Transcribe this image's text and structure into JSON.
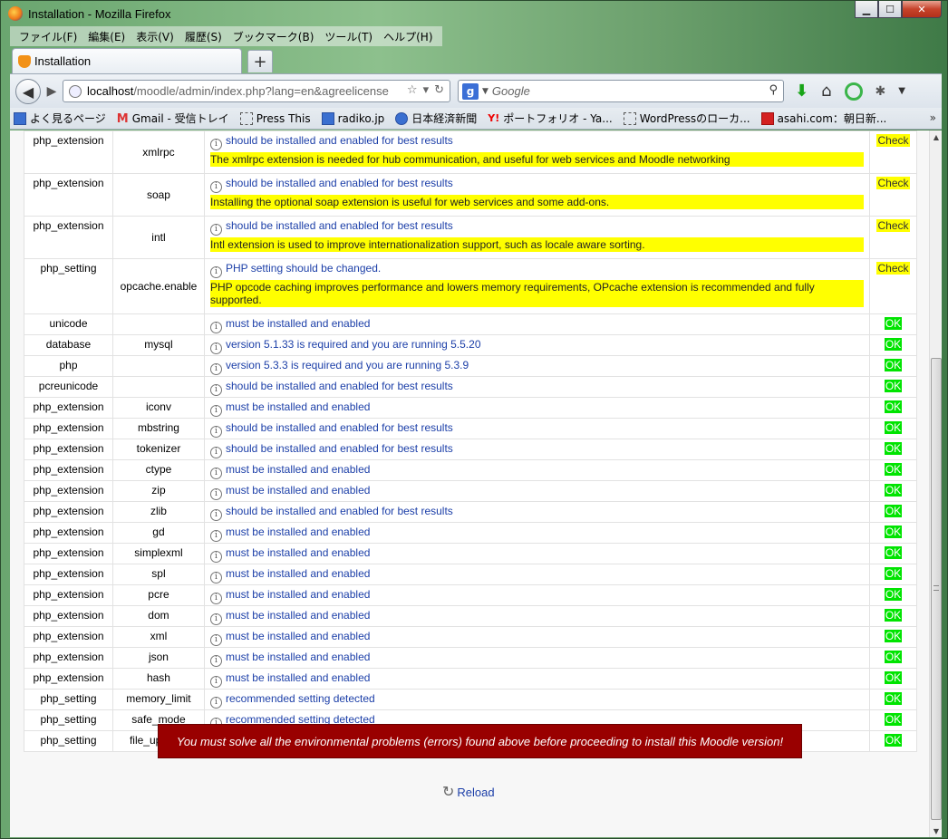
{
  "window": {
    "title": "Installation - Mozilla Firefox",
    "controls": {
      "minimize": "▁",
      "maximize": "☐",
      "close": "✕"
    }
  },
  "menubar": {
    "items": [
      "ファイル(F)",
      "編集(E)",
      "表示(V)",
      "履歴(S)",
      "ブックマーク(B)",
      "ツール(T)",
      "ヘルプ(H)"
    ]
  },
  "tabs": {
    "active_label": "Installation",
    "new_tab": "+"
  },
  "navbar": {
    "url_host": "localhost",
    "url_rest": "/moodle/admin/index.php?lang=en&agreelicense",
    "search_engine_letter": "g",
    "search_placeholder": "Google"
  },
  "bookmarks": {
    "items": [
      {
        "label": "よく見るページ",
        "icon": "bookmark-page-icon"
      },
      {
        "label": "Gmail - 受信トレイ",
        "icon": "gmail-icon"
      },
      {
        "label": "Press This",
        "icon": "dashed-page-icon"
      },
      {
        "label": "radiko.jp",
        "icon": "radiko-icon"
      },
      {
        "label": "日本経済新聞",
        "icon": "nikkei-icon"
      },
      {
        "label": "ポートフォリオ - Ya...",
        "icon": "yahoo-icon"
      },
      {
        "label": "WordPressのローカ...",
        "icon": "dashed-page-icon"
      },
      {
        "label": "asahi.com：朝日新...",
        "icon": "asahi-icon"
      }
    ],
    "more": "»"
  },
  "env_rows": [
    {
      "type": "php_extension",
      "name": "xmlrpc",
      "message": "should be installed and enabled for best results",
      "feedback": "The xmlrpc extension is needed for hub communication, and useful for web services and Moodle networking",
      "status": "Check"
    },
    {
      "type": "php_extension",
      "name": "soap",
      "message": "should be installed and enabled for best results",
      "feedback": "Installing the optional soap extension is useful for web services and some add-ons.",
      "status": "Check"
    },
    {
      "type": "php_extension",
      "name": "intl",
      "message": "should be installed and enabled for best results",
      "feedback": "Intl extension is used to improve internationalization support, such as locale aware sorting.",
      "status": "Check"
    },
    {
      "type": "php_setting",
      "name": "opcache.enable",
      "message": "PHP setting should be changed.",
      "feedback": "PHP opcode caching improves performance and lowers memory requirements, OPcache extension is recommended and fully supported.",
      "status": "Check"
    },
    {
      "type": "unicode",
      "name": "",
      "message": "must be installed and enabled",
      "feedback": "",
      "status": "OK"
    },
    {
      "type": "database",
      "name": "mysql",
      "message": "version 5.1.33 is required and you are running 5.5.20",
      "feedback": "",
      "status": "OK"
    },
    {
      "type": "php",
      "name": "",
      "message": "version 5.3.3 is required and you are running 5.3.9",
      "feedback": "",
      "status": "OK"
    },
    {
      "type": "pcreunicode",
      "name": "",
      "message": "should be installed and enabled for best results",
      "feedback": "",
      "status": "OK"
    },
    {
      "type": "php_extension",
      "name": "iconv",
      "message": "must be installed and enabled",
      "feedback": "",
      "status": "OK"
    },
    {
      "type": "php_extension",
      "name": "mbstring",
      "message": "should be installed and enabled for best results",
      "feedback": "",
      "status": "OK"
    },
    {
      "type": "php_extension",
      "name": "tokenizer",
      "message": "should be installed and enabled for best results",
      "feedback": "",
      "status": "OK"
    },
    {
      "type": "php_extension",
      "name": "ctype",
      "message": "must be installed and enabled",
      "feedback": "",
      "status": "OK"
    },
    {
      "type": "php_extension",
      "name": "zip",
      "message": "must be installed and enabled",
      "feedback": "",
      "status": "OK"
    },
    {
      "type": "php_extension",
      "name": "zlib",
      "message": "should be installed and enabled for best results",
      "feedback": "",
      "status": "OK"
    },
    {
      "type": "php_extension",
      "name": "gd",
      "message": "must be installed and enabled",
      "feedback": "",
      "status": "OK"
    },
    {
      "type": "php_extension",
      "name": "simplexml",
      "message": "must be installed and enabled",
      "feedback": "",
      "status": "OK"
    },
    {
      "type": "php_extension",
      "name": "spl",
      "message": "must be installed and enabled",
      "feedback": "",
      "status": "OK"
    },
    {
      "type": "php_extension",
      "name": "pcre",
      "message": "must be installed and enabled",
      "feedback": "",
      "status": "OK"
    },
    {
      "type": "php_extension",
      "name": "dom",
      "message": "must be installed and enabled",
      "feedback": "",
      "status": "OK"
    },
    {
      "type": "php_extension",
      "name": "xml",
      "message": "must be installed and enabled",
      "feedback": "",
      "status": "OK"
    },
    {
      "type": "php_extension",
      "name": "json",
      "message": "must be installed and enabled",
      "feedback": "",
      "status": "OK"
    },
    {
      "type": "php_extension",
      "name": "hash",
      "message": "must be installed and enabled",
      "feedback": "",
      "status": "OK"
    },
    {
      "type": "php_setting",
      "name": "memory_limit",
      "message": "recommended setting detected",
      "feedback": "",
      "status": "OK"
    },
    {
      "type": "php_setting",
      "name": "safe_mode",
      "message": "recommended setting detected",
      "feedback": "",
      "status": "OK"
    },
    {
      "type": "php_setting",
      "name": "file_uploads",
      "message": "recommended setting detected",
      "feedback": "",
      "status": "OK"
    }
  ],
  "error_message": "You must solve all the environmental problems (errors) found above before proceeding to install this Moodle version!",
  "reload_label": "Reload",
  "colors": {
    "check_bg": "#ffff00",
    "ok_bg": "#00e400",
    "error_bg": "#990000",
    "link": "#1c3fa8"
  }
}
